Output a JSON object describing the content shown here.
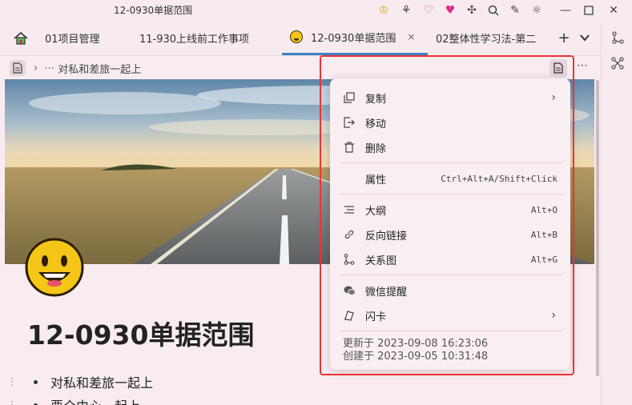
{
  "window": {
    "title": "12-0930单据范围"
  },
  "tabs": [
    {
      "label": "01项目管理"
    },
    {
      "label": "11-930上线前工作事项"
    },
    {
      "label": "12-0930单据范围",
      "close": "×"
    },
    {
      "label": "02整体性学习法-第二"
    }
  ],
  "tabbar_icons": {
    "add": "+",
    "more": "chevron-down-icon"
  },
  "breadcrumb": {
    "item": "对私和差旅一起上"
  },
  "document": {
    "title": "12-0930单据范围",
    "list": [
      {
        "text": "对私和差旅一起上"
      },
      {
        "text": "覀仝由心一起上"
      }
    ]
  },
  "menu": {
    "items": [
      {
        "label": "复制",
        "icon": "copy-icon",
        "arrow": "›"
      },
      {
        "label": "移动",
        "icon": "move-icon"
      },
      {
        "label": "删除",
        "icon": "trash-icon"
      },
      {
        "label": "属性",
        "shortcut": "Ctrl+Alt+A/Shift+Click"
      },
      {
        "label": "大纲",
        "icon": "outline-icon",
        "shortcut": "Alt+O"
      },
      {
        "label": "反向链接",
        "icon": "link-icon",
        "shortcut": "Alt+B"
      },
      {
        "label": "关系图",
        "icon": "graph-icon",
        "shortcut": "Alt+G"
      },
      {
        "label": "微信提醒",
        "icon": "wechat-icon"
      },
      {
        "label": "闪卡",
        "icon": "flashcard-icon",
        "arrow": "›"
      }
    ],
    "updated": "更新于 2023-09-08 16:23:06",
    "created": "创建于 2023-09-05 10:31:48"
  },
  "colors": {
    "accent": "#3b82c4",
    "highlight": "#e33333",
    "background": "#f8ecf0"
  }
}
